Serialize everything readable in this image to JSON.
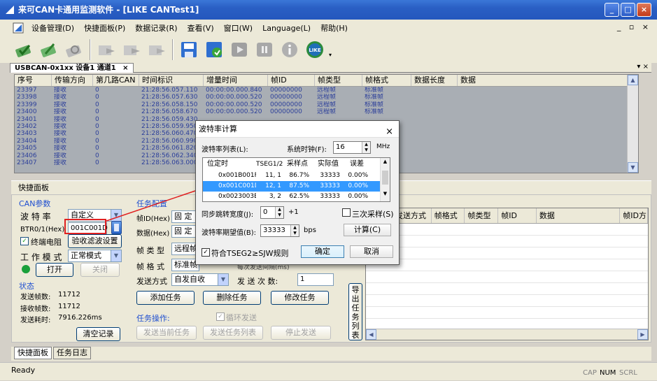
{
  "window": {
    "title": "来可CAN卡通用监测软件 - [LIKE CANTest1]",
    "minimize": "_",
    "maximize": "□",
    "close": "×"
  },
  "menu": {
    "items": [
      "设备管理(D)",
      "快捷面板(P)",
      "数据记录(R)",
      "查看(V)",
      "窗口(W)",
      "Language(L)",
      "帮助(H)"
    ],
    "mdi_controls": "_ ▫ ×"
  },
  "doc_tab": {
    "label": "USBCAN-0x1xx 设备1 通道1",
    "close": "×",
    "right_controls": "▾ ×"
  },
  "grid": {
    "columns": [
      "序号",
      "传输方向",
      "第几路CAN",
      "时间标识",
      "增量时间",
      "帧ID",
      "帧类型",
      "帧格式",
      "数据长度",
      "数据"
    ],
    "rows": [
      [
        "23397",
        "接收",
        "0",
        "21:28:56.057.110",
        "00:00:00.000.840",
        "00000000",
        "远程帧",
        "标准帧",
        "",
        ""
      ],
      [
        "23398",
        "接收",
        "0",
        "21:28:56.057.630",
        "00:00:00.000.520",
        "00000000",
        "远程帧",
        "标准帧",
        "",
        ""
      ],
      [
        "23399",
        "接收",
        "0",
        "21:28:56.058.150",
        "00:00:00.000.520",
        "00000000",
        "远程帧",
        "标准帧",
        "",
        ""
      ],
      [
        "23400",
        "接收",
        "0",
        "21:28:56.058.670",
        "00:00:00.000.520",
        "00000000",
        "远程帧",
        "标准帧",
        "",
        ""
      ],
      [
        "23401",
        "接收",
        "0",
        "21:28:56.059.430",
        "",
        "",
        "",
        "",
        "",
        ""
      ],
      [
        "23402",
        "接收",
        "0",
        "21:28:56.059.950",
        "",
        "",
        "",
        "",
        "",
        ""
      ],
      [
        "23403",
        "接收",
        "0",
        "21:28:56.060.470",
        "",
        "",
        "",
        "",
        "",
        ""
      ],
      [
        "23404",
        "接收",
        "0",
        "21:28:56.060.990",
        "",
        "",
        "",
        "",
        "",
        ""
      ],
      [
        "23405",
        "接收",
        "0",
        "21:28:56.061.820",
        "",
        "",
        "",
        "",
        "",
        ""
      ],
      [
        "23406",
        "接收",
        "0",
        "21:28:56.062.340",
        "",
        "",
        "",
        "",
        "",
        ""
      ],
      [
        "23407",
        "接收",
        "0",
        "21:28:56.063.000",
        "",
        "",
        "",
        "",
        "",
        ""
      ]
    ]
  },
  "quick_panel": {
    "header": "快捷面板",
    "can_params": {
      "group": "CAN参数",
      "baud_label": "波 特 率",
      "baud_value": "自定义",
      "btr_label": "BTR0/1(Hex)",
      "btr_value": "001C001D",
      "terminal_resistor": "终端电阻",
      "filter_button": "验收滤波设置",
      "mode_label": "工 作 模 式",
      "mode_value": "正常模式",
      "open_button": "打开",
      "close_button": "关闭"
    },
    "status": {
      "group": "状态",
      "sent_frames_label": "发送帧数:",
      "sent_frames": "11712",
      "recv_frames_label": "接收帧数:",
      "recv_frames": "11712",
      "send_time_label": "发送耗时:",
      "send_time": "7916.226ms",
      "clear_button": "清空记录"
    },
    "task_config": {
      "group": "任务配置",
      "frame_id_label": "帧ID(Hex)",
      "frame_id_prefix": "固  定",
      "data_label": "数据(Hex)",
      "data_prefix": "固  定",
      "frame_type_label": "帧 类 型",
      "frame_type_value": "远程帧",
      "frame_format_label": "帧 格 式",
      "frame_format_value": "标准帧",
      "send_interval_label": "每次发送间隔(ms)",
      "send_mode_label": "发送方式",
      "send_mode_value": "自发自收",
      "send_count_label": "发 送 次 数:",
      "send_count_value": "1",
      "add_task": "添加任务",
      "delete_task": "删除任务",
      "modify_task": "修改任务"
    },
    "task_ops": {
      "group": "任务操作:",
      "loop_send": "循环发送",
      "send_current": "发送当前任务",
      "send_list": "发送任务列表",
      "stop_send": "停止发送"
    },
    "export_button": "导出任务列表",
    "send_grid_columns": [
      "发送方式",
      "帧格式",
      "帧类型",
      "帧ID",
      "数据",
      "帧ID方"
    ]
  },
  "bottom_tabs": [
    "快捷面板",
    "任务日志"
  ],
  "statusbar": {
    "text": "Ready",
    "indicators": [
      "CAP",
      "NUM",
      "SCRL"
    ]
  },
  "dialog": {
    "title": "波特率计算",
    "close": "×",
    "baud_list_label": "波特率列表(L):",
    "sys_clock_label": "系统时钟(F):",
    "sys_clock_value": "16",
    "sys_clock_unit": "MHz",
    "list_columns": [
      "位定时",
      "TSEG1/2",
      "采样点",
      "实际值",
      "误差"
    ],
    "list_rows": [
      [
        "0x001B001F",
        "11, 1",
        "86.7%",
        "33333",
        "0.00%"
      ],
      [
        "0x001C001D",
        "12, 1",
        "87.5%",
        "33333",
        "0.00%"
      ],
      [
        "0x0023003B",
        "3, 2",
        "62.5%",
        "33333",
        "0.00%"
      ]
    ],
    "selected_row": 1,
    "sjw_label": "同步跳转宽度(J):",
    "sjw_value": "0",
    "sjw_suffix": "+1",
    "triple_sample": "三次采样(S)",
    "expected_label": "波特率期望值(B):",
    "expected_value": "33333",
    "expected_unit": "bps",
    "calc_button": "计算(C)",
    "tseg_rule": "符合TSEG2≥SJW规则",
    "ok_button": "确定",
    "cancel_button": "取消"
  }
}
